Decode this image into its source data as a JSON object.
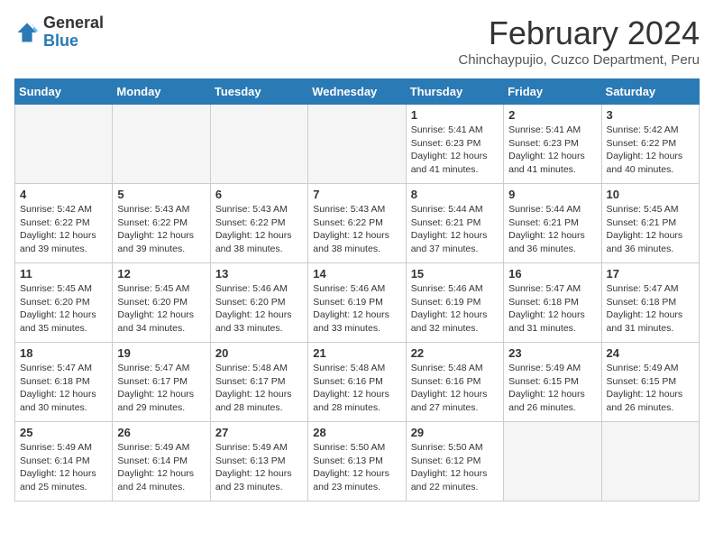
{
  "logo": {
    "general": "General",
    "blue": "Blue"
  },
  "header": {
    "title": "February 2024",
    "subtitle": "Chinchaypujio, Cuzco Department, Peru"
  },
  "days_of_week": [
    "Sunday",
    "Monday",
    "Tuesday",
    "Wednesday",
    "Thursday",
    "Friday",
    "Saturday"
  ],
  "weeks": [
    [
      {
        "day": "",
        "info": ""
      },
      {
        "day": "",
        "info": ""
      },
      {
        "day": "",
        "info": ""
      },
      {
        "day": "",
        "info": ""
      },
      {
        "day": "1",
        "info": "Sunrise: 5:41 AM\nSunset: 6:23 PM\nDaylight: 12 hours\nand 41 minutes."
      },
      {
        "day": "2",
        "info": "Sunrise: 5:41 AM\nSunset: 6:23 PM\nDaylight: 12 hours\nand 41 minutes."
      },
      {
        "day": "3",
        "info": "Sunrise: 5:42 AM\nSunset: 6:22 PM\nDaylight: 12 hours\nand 40 minutes."
      }
    ],
    [
      {
        "day": "4",
        "info": "Sunrise: 5:42 AM\nSunset: 6:22 PM\nDaylight: 12 hours\nand 39 minutes."
      },
      {
        "day": "5",
        "info": "Sunrise: 5:43 AM\nSunset: 6:22 PM\nDaylight: 12 hours\nand 39 minutes."
      },
      {
        "day": "6",
        "info": "Sunrise: 5:43 AM\nSunset: 6:22 PM\nDaylight: 12 hours\nand 38 minutes."
      },
      {
        "day": "7",
        "info": "Sunrise: 5:43 AM\nSunset: 6:22 PM\nDaylight: 12 hours\nand 38 minutes."
      },
      {
        "day": "8",
        "info": "Sunrise: 5:44 AM\nSunset: 6:21 PM\nDaylight: 12 hours\nand 37 minutes."
      },
      {
        "day": "9",
        "info": "Sunrise: 5:44 AM\nSunset: 6:21 PM\nDaylight: 12 hours\nand 36 minutes."
      },
      {
        "day": "10",
        "info": "Sunrise: 5:45 AM\nSunset: 6:21 PM\nDaylight: 12 hours\nand 36 minutes."
      }
    ],
    [
      {
        "day": "11",
        "info": "Sunrise: 5:45 AM\nSunset: 6:20 PM\nDaylight: 12 hours\nand 35 minutes."
      },
      {
        "day": "12",
        "info": "Sunrise: 5:45 AM\nSunset: 6:20 PM\nDaylight: 12 hours\nand 34 minutes."
      },
      {
        "day": "13",
        "info": "Sunrise: 5:46 AM\nSunset: 6:20 PM\nDaylight: 12 hours\nand 33 minutes."
      },
      {
        "day": "14",
        "info": "Sunrise: 5:46 AM\nSunset: 6:19 PM\nDaylight: 12 hours\nand 33 minutes."
      },
      {
        "day": "15",
        "info": "Sunrise: 5:46 AM\nSunset: 6:19 PM\nDaylight: 12 hours\nand 32 minutes."
      },
      {
        "day": "16",
        "info": "Sunrise: 5:47 AM\nSunset: 6:18 PM\nDaylight: 12 hours\nand 31 minutes."
      },
      {
        "day": "17",
        "info": "Sunrise: 5:47 AM\nSunset: 6:18 PM\nDaylight: 12 hours\nand 31 minutes."
      }
    ],
    [
      {
        "day": "18",
        "info": "Sunrise: 5:47 AM\nSunset: 6:18 PM\nDaylight: 12 hours\nand 30 minutes."
      },
      {
        "day": "19",
        "info": "Sunrise: 5:47 AM\nSunset: 6:17 PM\nDaylight: 12 hours\nand 29 minutes."
      },
      {
        "day": "20",
        "info": "Sunrise: 5:48 AM\nSunset: 6:17 PM\nDaylight: 12 hours\nand 28 minutes."
      },
      {
        "day": "21",
        "info": "Sunrise: 5:48 AM\nSunset: 6:16 PM\nDaylight: 12 hours\nand 28 minutes."
      },
      {
        "day": "22",
        "info": "Sunrise: 5:48 AM\nSunset: 6:16 PM\nDaylight: 12 hours\nand 27 minutes."
      },
      {
        "day": "23",
        "info": "Sunrise: 5:49 AM\nSunset: 6:15 PM\nDaylight: 12 hours\nand 26 minutes."
      },
      {
        "day": "24",
        "info": "Sunrise: 5:49 AM\nSunset: 6:15 PM\nDaylight: 12 hours\nand 26 minutes."
      }
    ],
    [
      {
        "day": "25",
        "info": "Sunrise: 5:49 AM\nSunset: 6:14 PM\nDaylight: 12 hours\nand 25 minutes."
      },
      {
        "day": "26",
        "info": "Sunrise: 5:49 AM\nSunset: 6:14 PM\nDaylight: 12 hours\nand 24 minutes."
      },
      {
        "day": "27",
        "info": "Sunrise: 5:49 AM\nSunset: 6:13 PM\nDaylight: 12 hours\nand 23 minutes."
      },
      {
        "day": "28",
        "info": "Sunrise: 5:50 AM\nSunset: 6:13 PM\nDaylight: 12 hours\nand 23 minutes."
      },
      {
        "day": "29",
        "info": "Sunrise: 5:50 AM\nSunset: 6:12 PM\nDaylight: 12 hours\nand 22 minutes."
      },
      {
        "day": "",
        "info": ""
      },
      {
        "day": "",
        "info": ""
      }
    ]
  ]
}
